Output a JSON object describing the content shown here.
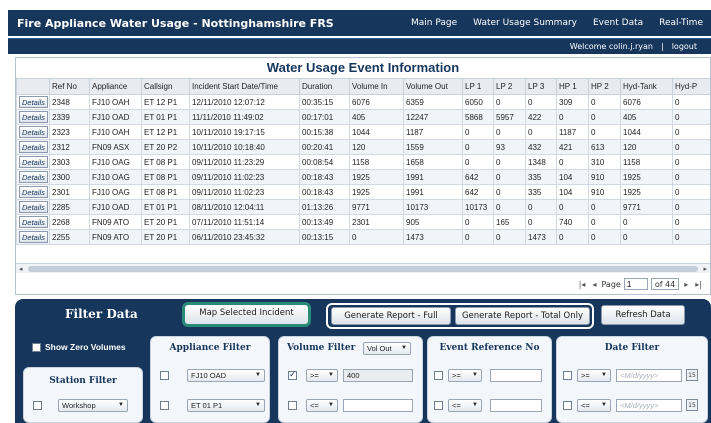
{
  "header": {
    "title": "Fire Appliance Water Usage - Nottinghamshire FRS",
    "nav": [
      "Main Page",
      "Water Usage Summary",
      "Event Data",
      "Real-Time"
    ]
  },
  "userbar": {
    "welcome": "Welcome colin.j.ryan",
    "separator": "|",
    "logout": "logout"
  },
  "grid": {
    "title": "Water Usage Event Information",
    "columns": [
      "",
      "Ref No",
      "Appliance",
      "Callsign",
      "Incident Start Date/Time",
      "Duration",
      "Volume In",
      "Volume Out",
      "LP 1",
      "LP 2",
      "LP 3",
      "HP 1",
      "HP 2",
      "Hyd-Tank",
      "Hyd-P"
    ],
    "details_label": "Details",
    "rows": [
      [
        "2348",
        "FJ10 OAH",
        "ET 12 P1",
        "12/11/2010 12:07:12",
        "00:35:15",
        "6076",
        "6359",
        "6050",
        "0",
        "0",
        "309",
        "0",
        "6076",
        "0"
      ],
      [
        "2339",
        "FJ10 OAD",
        "ET 01 P1",
        "11/11/2010 11:49:02",
        "00:17:01",
        "405",
        "12247",
        "5868",
        "5957",
        "422",
        "0",
        "0",
        "405",
        "0"
      ],
      [
        "2323",
        "FJ10 OAH",
        "ET 12 P1",
        "10/11/2010 19:17:15",
        "00:15:38",
        "1044",
        "1187",
        "0",
        "0",
        "0",
        "1187",
        "0",
        "1044",
        "0"
      ],
      [
        "2312",
        "FN09 ASX",
        "ET 20 P2",
        "10/11/2010 10:18:40",
        "00:20:41",
        "120",
        "1559",
        "0",
        "93",
        "432",
        "421",
        "613",
        "120",
        "0"
      ],
      [
        "2303",
        "FJ10 OAG",
        "ET 08 P1",
        "09/11/2010 11:23:29",
        "00:08:54",
        "1158",
        "1658",
        "0",
        "0",
        "1348",
        "0",
        "310",
        "1158",
        "0"
      ],
      [
        "2300",
        "FJ10 OAG",
        "ET 08 P1",
        "09/11/2010 11:02:23",
        "00:18:43",
        "1925",
        "1991",
        "642",
        "0",
        "335",
        "104",
        "910",
        "1925",
        "0"
      ],
      [
        "2301",
        "FJ10 OAG",
        "ET 08 P1",
        "09/11/2010 11:02:23",
        "00:18:43",
        "1925",
        "1991",
        "642",
        "0",
        "335",
        "104",
        "910",
        "1925",
        "0"
      ],
      [
        "2285",
        "FJ10 OAD",
        "ET 01 P1",
        "08/11/2010 12:04:11",
        "01:13:26",
        "9771",
        "10173",
        "10173",
        "0",
        "0",
        "0",
        "0",
        "9771",
        "0"
      ],
      [
        "2268",
        "FN09 ATO",
        "ET 20 P1",
        "07/11/2010 11:51:14",
        "00:13:49",
        "2301",
        "905",
        "0",
        "165",
        "0",
        "740",
        "0",
        "0",
        "0"
      ],
      [
        "2255",
        "FN09 ATO",
        "ET 20 P1",
        "06/11/2010 23:45:32",
        "00:13:15",
        "0",
        "1473",
        "0",
        "0",
        "1473",
        "0",
        "0",
        "0",
        "0"
      ]
    ],
    "pager": {
      "page_label": "Page",
      "current_page": "1",
      "total_label": "of 44",
      "first": "|◂",
      "prev": "◂",
      "next": "▸",
      "last": "▸|"
    }
  },
  "filter": {
    "title": "Filter Data",
    "map_button": "Map Selected Incident",
    "report_full_button": "Generate Report - Full",
    "report_total_button": "Generate Report - Total Only",
    "refresh_button": "Refresh Data",
    "show_zero_label": "Show Zero Volumes",
    "station": {
      "title": "Station Filter",
      "value": "Workshop"
    },
    "appliance": {
      "title": "Appliance Filter",
      "value1": "FJ10 OAD",
      "value2": "ET 01 P1"
    },
    "volume": {
      "title": "Volume Filter",
      "type_value": "Vol Out",
      "op1": ">=",
      "val1": "400",
      "op2": "<=",
      "val2": ""
    },
    "eventref": {
      "title": "Event Reference No",
      "op1": ">=",
      "op2": "<="
    },
    "date": {
      "title": "Date Filter",
      "op1": ">=",
      "op2": "<=",
      "placeholder": "<M/d/yyyy>",
      "cal_label": "15"
    }
  },
  "colors": {
    "header_bg": "#16365c",
    "panel_light": "#f3f6fa",
    "map_border": "#2a8a78"
  }
}
